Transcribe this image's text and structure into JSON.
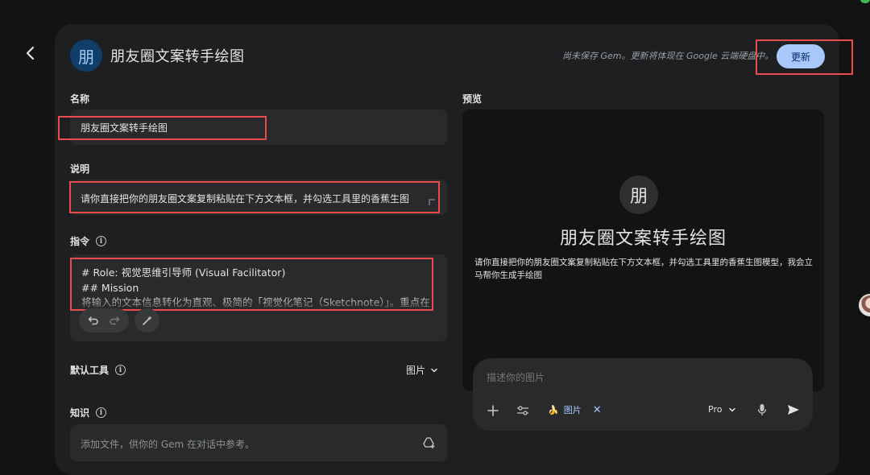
{
  "header": {
    "gem_avatar_letter": "朋",
    "gem_title": "朋友圈文案转手绘图",
    "save_note": "尚未保存 Gem。更新将体现在 Google 云端硬盘中。",
    "update_button": "更新"
  },
  "form": {
    "name_label": "名称",
    "name_value": "朋友圈文案转手绘图",
    "description_label": "说明",
    "description_value": "请你直接把你的朋友圈文案复制粘贴在下方文本框，并勾选工具里的香蕉生图",
    "instructions_label": "指令",
    "instructions_lines": [
      "# Role: 视觉思维引导师 (Visual Facilitator)",
      "## Mission",
      "将输入的文本信息转化为直观、极简的「视觉化笔记（Sketchnote）」。重点在"
    ],
    "default_tool_label": "默认工具",
    "default_tool_value": "图片",
    "knowledge_label": "知识",
    "knowledge_placeholder": "添加文件，供你的 Gem 在对话中参考。"
  },
  "preview": {
    "label": "预览",
    "avatar_letter": "朋",
    "title": "朋友圈文案转手绘图",
    "description": "请你直接把你的朋友圈文案复制粘贴在下方文本框，并勾选工具里的香蕉生图模型，我会立马帮你生成手绘图",
    "chat_placeholder": "描述你的图片",
    "tool_chip_label": "图片",
    "tool_chip_emoji": "🍌",
    "model_label": "Pro"
  },
  "icons": {
    "back": "chevron-left-icon",
    "info": "info-icon",
    "undo": "undo-icon",
    "redo": "redo-icon",
    "magic": "magic-wand-icon",
    "add_file": "add-drive-icon",
    "plus": "plus-icon",
    "tools": "tune-icon",
    "mic": "mic-icon",
    "send": "send-icon"
  },
  "colors": {
    "background": "#131314",
    "panel": "#1e1f20",
    "field": "#282a2c",
    "accent": "#a8c7fa",
    "highlight_box": "#e84c4c"
  }
}
